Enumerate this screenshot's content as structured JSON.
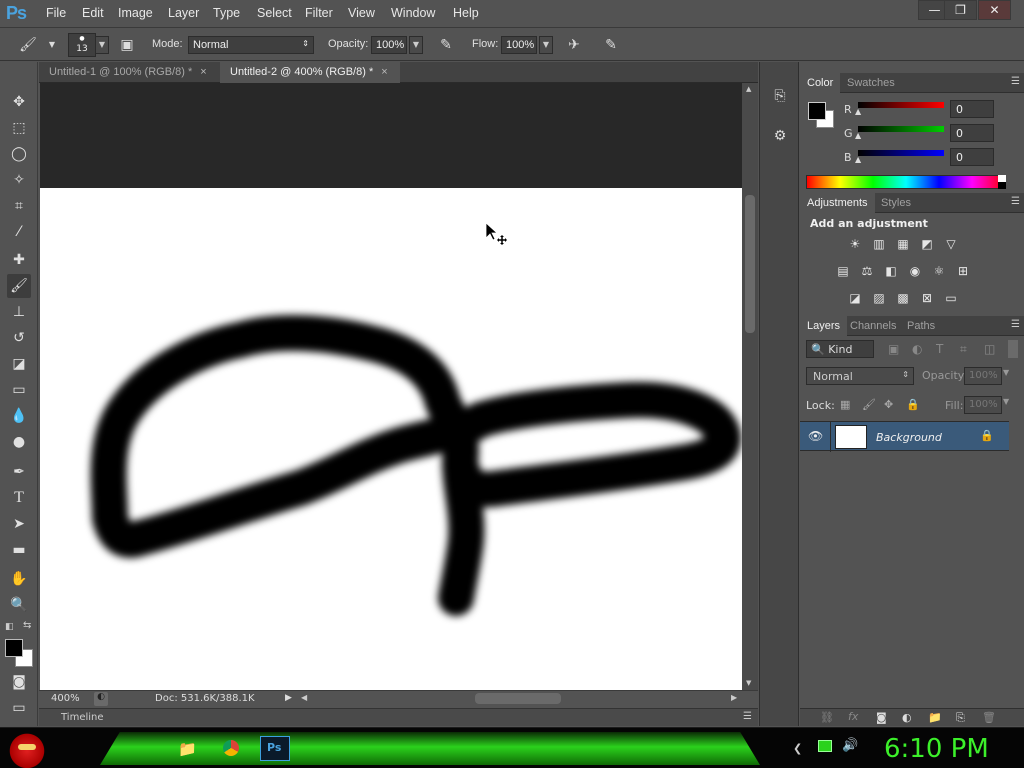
{
  "app": {
    "logo": "Ps"
  },
  "menu": [
    "File",
    "Edit",
    "Image",
    "Layer",
    "Type",
    "Select",
    "Filter",
    "View",
    "Window",
    "Help"
  ],
  "window_controls": {
    "minimize": "—",
    "restore": "❐",
    "close": "✕"
  },
  "options": {
    "brush_size": "13",
    "mode_label": "Mode:",
    "mode_value": "Normal",
    "opacity_label": "Opacity:",
    "opacity_value": "100%",
    "flow_label": "Flow:",
    "flow_value": "100%"
  },
  "tabs": [
    {
      "label": "Untitled-1 @ 100% (RGB/8) *",
      "active": false
    },
    {
      "label": "Untitled-2 @ 400% (RGB/8) *",
      "active": true
    }
  ],
  "tab_close": "×",
  "status": {
    "zoom": "400%",
    "doc": "Doc: 531.6K/388.1K"
  },
  "timeline": {
    "label": "Timeline"
  },
  "color_panel": {
    "tabs": [
      "Color",
      "Swatches"
    ],
    "channels": [
      {
        "name": "R",
        "value": "0",
        "color": "#ff0000"
      },
      {
        "name": "G",
        "value": "0",
        "color": "#00cc00"
      },
      {
        "name": "B",
        "value": "0",
        "color": "#0000ff"
      }
    ],
    "foreground": "#000000",
    "background": "#ffffff"
  },
  "adjustments_panel": {
    "tabs": [
      "Adjustments",
      "Styles"
    ],
    "title": "Add an adjustment"
  },
  "layers_panel": {
    "tabs": [
      "Layers",
      "Channels",
      "Paths"
    ],
    "filter_kind": "Kind",
    "blend_mode": "Normal",
    "opacity_label": "Opacity:",
    "opacity_value": "100%",
    "lock_label": "Lock:",
    "fill_label": "Fill:",
    "fill_value": "100%",
    "layers": [
      {
        "name": "Background",
        "visible": true,
        "locked": true
      }
    ]
  },
  "taskbar": {
    "clock": "6:10 PM",
    "ps_label": "Ps"
  }
}
